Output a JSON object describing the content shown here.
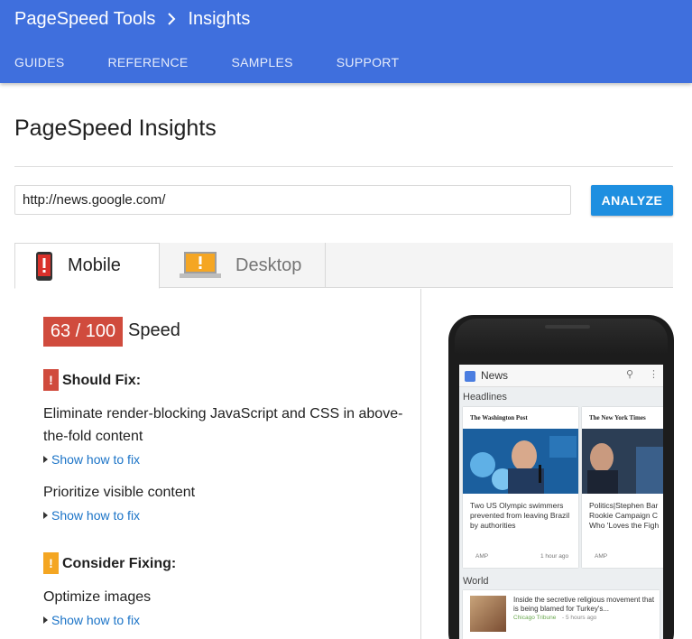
{
  "header": {
    "crumb_root": "PageSpeed Tools",
    "crumb_current": "Insights",
    "nav": [
      "GUIDES",
      "REFERENCE",
      "SAMPLES",
      "SUPPORT"
    ],
    "bg_color": "#3f6fdd"
  },
  "page_title": "PageSpeed Insights",
  "url_field": {
    "value": "http://news.google.com/"
  },
  "analyze_label": "ANALYZE",
  "tabs": {
    "mobile": "Mobile",
    "desktop": "Desktop",
    "selected": "Mobile"
  },
  "score": {
    "text": "63 / 100",
    "value": 63,
    "max": 100,
    "label": "Speed",
    "color": "#d04b3d"
  },
  "should_fix": {
    "heading": "Should Fix:",
    "badge": "!",
    "color": "#d04b3d",
    "rules": [
      {
        "text": "Eliminate render-blocking JavaScript and CSS in above-the-fold content",
        "link": "Show how to fix"
      },
      {
        "text": "Prioritize visible content",
        "link": "Show how to fix"
      }
    ]
  },
  "consider_fixing": {
    "heading": "Consider Fixing:",
    "badge": "!",
    "color": "#f4a622",
    "rules": [
      {
        "text": "Optimize images",
        "link": "Show how to fix"
      }
    ]
  },
  "phone_preview": {
    "app_title": "News",
    "headlines_label": "Headlines",
    "world_label": "World",
    "cards": [
      {
        "publisher": "The Washington Post",
        "headline": "Two US Olympic swimmers prevented from leaving Brazil by authorities",
        "badge": "AMP",
        "time": "1 hour ago"
      },
      {
        "publisher": "The New York Times",
        "headline": "Politics|Stephen Bar Rookie Campaign C Who 'Loves the Figh",
        "badge": "AMP",
        "time": ""
      }
    ],
    "world_card": {
      "headline": "Inside the secretive religious movement that is being blamed for Turkey's...",
      "source": "Chicago Tribune",
      "time": "- 5 hours ago"
    }
  }
}
